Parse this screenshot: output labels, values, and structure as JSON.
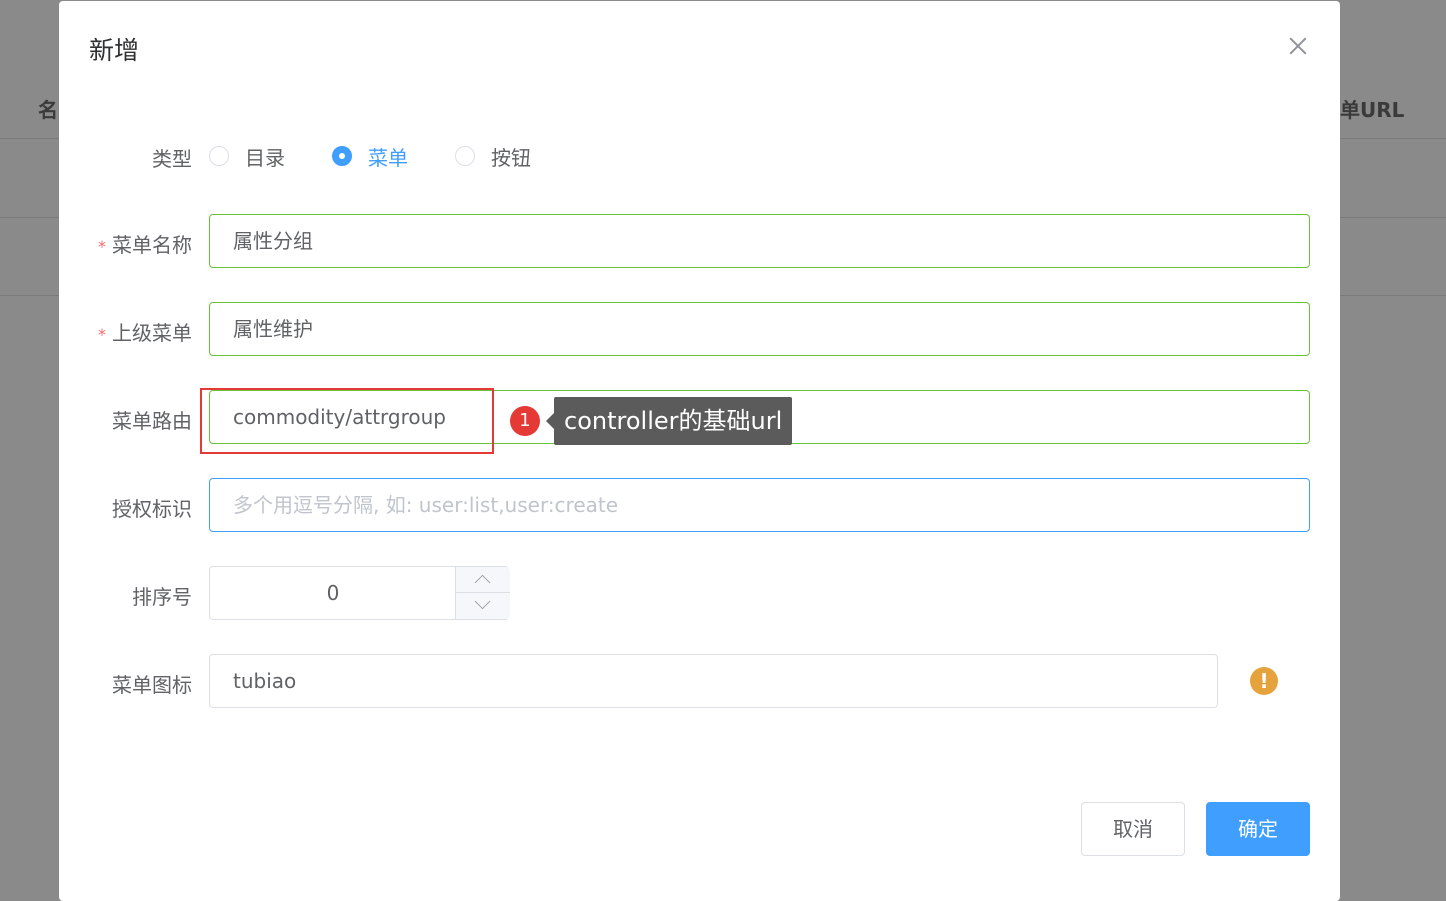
{
  "background": {
    "col_left": "名",
    "col_right": "单URL"
  },
  "dialog": {
    "title": "新增",
    "close_icon": "close-icon"
  },
  "form": {
    "type_label": "类型",
    "type_options": [
      "目录",
      "菜单",
      "按钮"
    ],
    "type_selected": "菜单",
    "name_label": "菜单名称",
    "name_value": "属性分组",
    "parent_label": "上级菜单",
    "parent_value": "属性维护",
    "route_label": "菜单路由",
    "route_value": "commodity/attrgroup",
    "perms_label": "授权标识",
    "perms_placeholder": "多个用逗号分隔, 如: user:list,user:create",
    "order_label": "排序号",
    "order_value": "0",
    "icon_label": "菜单图标",
    "icon_value": "tubiao",
    "required_mark": "*"
  },
  "annotation": {
    "number": "1",
    "text": "controller的基础url"
  },
  "buttons": {
    "cancel": "取消",
    "confirm": "确定"
  },
  "colors": {
    "primary": "#409eff",
    "success_border": "#67c23a",
    "warning": "#e6a23c",
    "annotation_red": "#e53935"
  }
}
